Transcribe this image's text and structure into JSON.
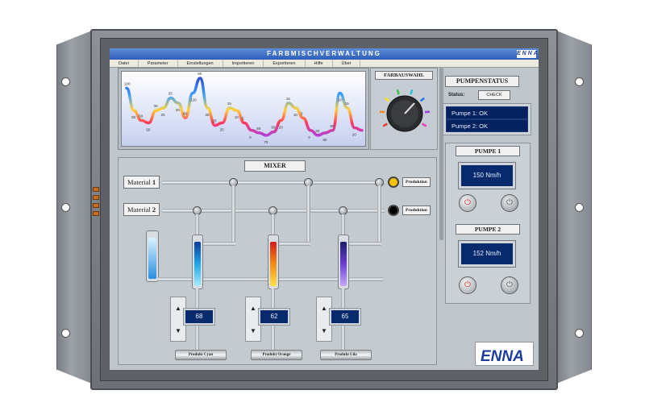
{
  "app": {
    "title": "FARBMISCHVERWALTUNG",
    "logo_text": "ENNA",
    "brand_color": "#1d3d9a"
  },
  "menu": [
    "Datei",
    "Parameter",
    "Einstellungen",
    "Importieren",
    "Exportieren",
    "Hilfe",
    "Über"
  ],
  "chart_data": {
    "type": "line",
    "x": [
      0,
      1,
      2,
      3,
      4,
      5,
      6,
      7,
      8,
      9,
      10,
      11,
      12,
      13,
      14,
      15,
      16,
      17,
      18,
      19,
      20,
      21,
      22,
      23,
      24,
      25,
      26,
      27,
      28,
      29,
      30,
      31,
      32
    ],
    "series": [
      {
        "values": [
          100,
          55,
          35,
          30,
          55,
          60,
          80,
          70,
          40,
          90,
          120,
          60,
          25,
          30,
          60,
          55,
          30,
          15,
          10,
          5,
          12,
          35,
          70,
          60,
          40,
          15,
          5,
          10,
          15,
          90,
          60,
          20,
          15
        ]
      }
    ],
    "data_labels": [
      "100",
      "80",
      "60",
      "50",
      "30",
      "25",
      "25",
      "20",
      "90",
      "120",
      "60",
      "40",
      "25",
      "25",
      "15",
      "10",
      "5",
      "0",
      "50",
      "70",
      "60",
      "20",
      "15",
      "10",
      "5",
      "0",
      "20",
      "90",
      "60",
      "10",
      "15",
      "20"
    ],
    "ylim": [
      0,
      120
    ],
    "grid": false,
    "colors": [
      "#2b4fd8",
      "#3ea0ff",
      "#ffd23a",
      "#ff3b5c",
      "#b23fd6"
    ]
  },
  "farbauswahl": {
    "title": "FARBAUSWAHL",
    "knob_colors": [
      "#e53935",
      "#f98b1a",
      "#f5e51c",
      "#37c04a",
      "#20c7d8",
      "#2b6fe8",
      "#9b3fe0",
      "#e83fb2"
    ]
  },
  "pumpenstatus": {
    "title": "PUMPENSTATUS",
    "status_label": "Status:",
    "check_button": "CHECK",
    "lines": [
      "Pumpe 1: OK",
      "Pumpe 2: OK"
    ]
  },
  "pumpe1": {
    "title": "PUMPE 1",
    "value": "150 Nm/h"
  },
  "pumpe2": {
    "title": "PUMPE 2",
    "value": "152 Nm/h"
  },
  "mixer": {
    "title": "MIXER",
    "material1": {
      "label": "Material",
      "number": "1",
      "produktion": "Produktion",
      "lamp_color": "#f5c400"
    },
    "material2": {
      "label": "Material",
      "number": "2",
      "produktion": "Produktion",
      "lamp_color": "#000000"
    },
    "tubes": [
      {
        "value": "68",
        "product": "Produkt Cyan",
        "fill": "#1ea6e8"
      },
      {
        "value": "62",
        "product": "Produkt Orange",
        "fill": "#f38c12"
      },
      {
        "value": "65",
        "product": "Produkt Lila",
        "fill": "#6a3fd1"
      }
    ],
    "arrow_up": "▲",
    "arrow_down": "▼"
  }
}
